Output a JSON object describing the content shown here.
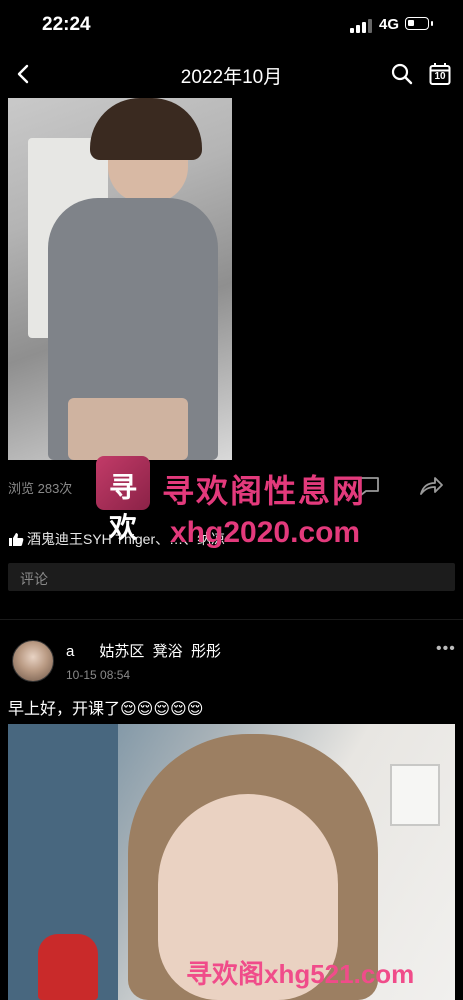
{
  "status_bar": {
    "time": "22:24",
    "network": "4G"
  },
  "nav": {
    "title": "2022年10月",
    "calendar_day": "10"
  },
  "post1": {
    "views": "浏览 283次",
    "likes": "酒鬼迪王SYH Thiger、…、纳凉",
    "comment_placeholder": "评论"
  },
  "post2": {
    "name": "a      姑苏区  凳浴  彤彤",
    "time": "10-15 08:54",
    "text": "早上好，开课了😌😌😌😌😌",
    "more": "•••"
  },
  "watermark": {
    "logo": "寻欢",
    "title": "寻欢阁性息网",
    "url1": "xhg2020.com",
    "url2": "寻欢阁xhg521.com"
  }
}
